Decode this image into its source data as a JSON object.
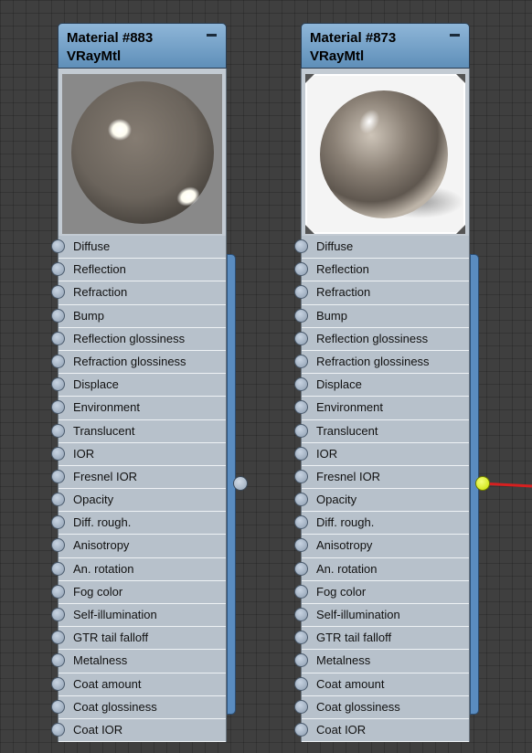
{
  "nodes": [
    {
      "title": "Material #883",
      "subtitle": "VRayMtl",
      "slots": [
        "Diffuse",
        "Reflection",
        "Refraction",
        "Bump",
        "Reflection glossiness",
        "Refraction glossiness",
        "Displace",
        "Environment",
        "Translucent",
        "IOR",
        "Fresnel IOR",
        "Opacity",
        "Diff. rough.",
        "Anisotropy",
        "An. rotation",
        "Fog color",
        "Self-illumination",
        "GTR tail falloff",
        "Metalness",
        "Coat amount",
        "Coat glossiness",
        "Coat IOR"
      ]
    },
    {
      "title": "Material #873",
      "subtitle": "VRayMtl",
      "slots": [
        "Diffuse",
        "Reflection",
        "Refraction",
        "Bump",
        "Reflection glossiness",
        "Refraction glossiness",
        "Displace",
        "Environment",
        "Translucent",
        "IOR",
        "Fresnel IOR",
        "Opacity",
        "Diff. rough.",
        "Anisotropy",
        "An. rotation",
        "Fog color",
        "Self-illumination",
        "GTR tail falloff",
        "Metalness",
        "Coat amount",
        "Coat glossiness",
        "Coat IOR"
      ]
    }
  ],
  "colors": {
    "header": "#7aa6cc",
    "slot_bg": "#b7c1cb",
    "output_connected": "#d8f000",
    "wire": "#d62020"
  }
}
